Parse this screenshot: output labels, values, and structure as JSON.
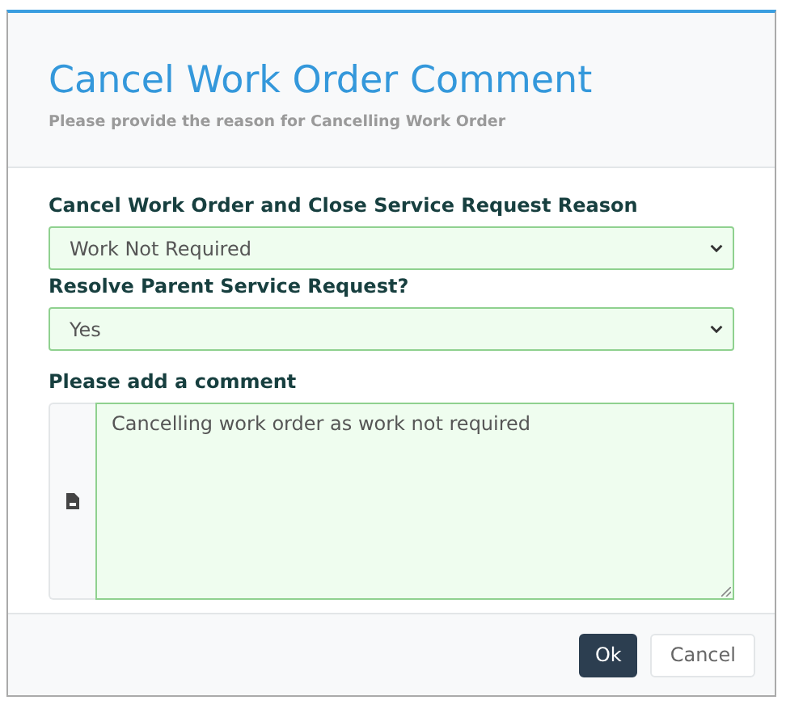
{
  "dialog": {
    "title": "Cancel Work Order Comment",
    "subtitle": "Please provide the reason for Cancelling Work Order"
  },
  "fields": [
    {
      "kind": "select",
      "label": "Cancel Work Order and Close Service Request Reason",
      "value": "Work Not Required"
    },
    {
      "kind": "select",
      "label": "Resolve Parent Service Request?",
      "value": "Yes"
    },
    {
      "kind": "textarea",
      "label": "Please add a comment",
      "value": "Cancelling work order as work not required"
    }
  ],
  "buttons": [
    {
      "label": "Ok",
      "kind": "primary"
    },
    {
      "label": "Cancel",
      "kind": "default"
    }
  ]
}
